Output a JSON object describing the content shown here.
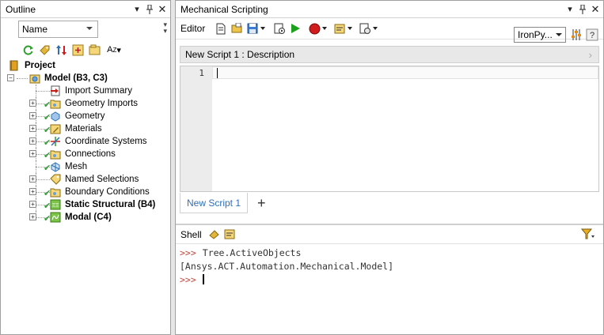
{
  "outline": {
    "title": "Outline",
    "name_filter": "Name",
    "tree": [
      {
        "label": "Project",
        "bold": true
      },
      {
        "label": "Model (B3, C3)",
        "bold": true
      },
      {
        "label": "Import Summary",
        "bold": false
      },
      {
        "label": "Geometry Imports",
        "bold": false
      },
      {
        "label": "Geometry",
        "bold": false
      },
      {
        "label": "Materials",
        "bold": false
      },
      {
        "label": "Coordinate Systems",
        "bold": false
      },
      {
        "label": "Connections",
        "bold": false
      },
      {
        "label": "Mesh",
        "bold": false
      },
      {
        "label": "Named Selections",
        "bold": false
      },
      {
        "label": "Boundary Conditions",
        "bold": false
      },
      {
        "label": "Static Structural (B4)",
        "bold": true
      },
      {
        "label": "Modal (C4)",
        "bold": true
      }
    ]
  },
  "scripting": {
    "title": "Mechanical Scripting",
    "editor_label": "Editor",
    "language": "IronPy...",
    "description": "New Script 1  : Description",
    "line_number": "1",
    "tab": "New Script 1",
    "add_tab": "+",
    "shell_label": "Shell",
    "shell_lines": [
      {
        "prompt": ">>>",
        "text": "Tree.ActiveObjects"
      },
      {
        "prompt": "",
        "text": "[Ansys.ACT.Automation.Mechanical.Model]"
      },
      {
        "prompt": ">>>",
        "text": ""
      }
    ]
  },
  "colors": {
    "accent_tab": "#2f6fb5",
    "prompt": "#c5473f",
    "check": "#2e9e2e",
    "run": "#1aa31a",
    "record": "#d01c1c"
  }
}
